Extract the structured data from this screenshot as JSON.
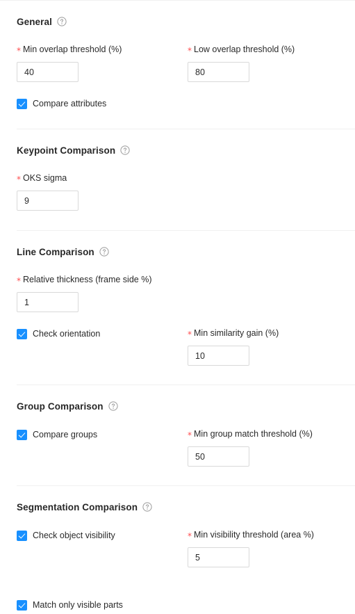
{
  "form": {
    "icons": {
      "help": "question-circle-icon",
      "check": "check-icon"
    },
    "colors": {
      "accent": "#1890ff",
      "required_star": "#ff4d4f",
      "divider": "#f0f0f0",
      "border": "#d9d9d9",
      "text": "rgba(0,0,0,0.85)"
    },
    "required_marker": "*",
    "sections": [
      {
        "id": "general",
        "title": "General",
        "fields": [
          {
            "label": "Min overlap threshold (%)",
            "value": "40",
            "required": true
          },
          {
            "label": "Low overlap threshold (%)",
            "value": "80",
            "required": true
          }
        ],
        "checkboxes": [
          {
            "label": "Compare attributes",
            "checked": true
          }
        ]
      },
      {
        "id": "keypoint-comparison",
        "title": "Keypoint Comparison",
        "fields": [
          {
            "label": "OKS sigma",
            "value": "9",
            "required": true
          }
        ],
        "checkboxes": []
      },
      {
        "id": "line-comparison",
        "title": "Line Comparison",
        "fields": [
          {
            "label": "Relative thickness (frame side %)",
            "value": "1",
            "required": true
          },
          {
            "label": "Min similarity gain (%)",
            "value": "10",
            "required": true
          }
        ],
        "checkboxes": [
          {
            "label": "Check orientation",
            "checked": true
          }
        ]
      },
      {
        "id": "group-comparison",
        "title": "Group Comparison",
        "fields": [
          {
            "label": "Min group match threshold (%)",
            "value": "50",
            "required": true
          }
        ],
        "checkboxes": [
          {
            "label": "Compare groups",
            "checked": true
          }
        ]
      },
      {
        "id": "segmentation-comparison",
        "title": "Segmentation Comparison",
        "fields": [
          {
            "label": "Min visibility threshold (area %)",
            "value": "5",
            "required": true
          }
        ],
        "checkboxes": [
          {
            "label": "Check object visibility",
            "checked": true
          },
          {
            "label": "Match only visible parts",
            "checked": true
          }
        ]
      }
    ]
  }
}
